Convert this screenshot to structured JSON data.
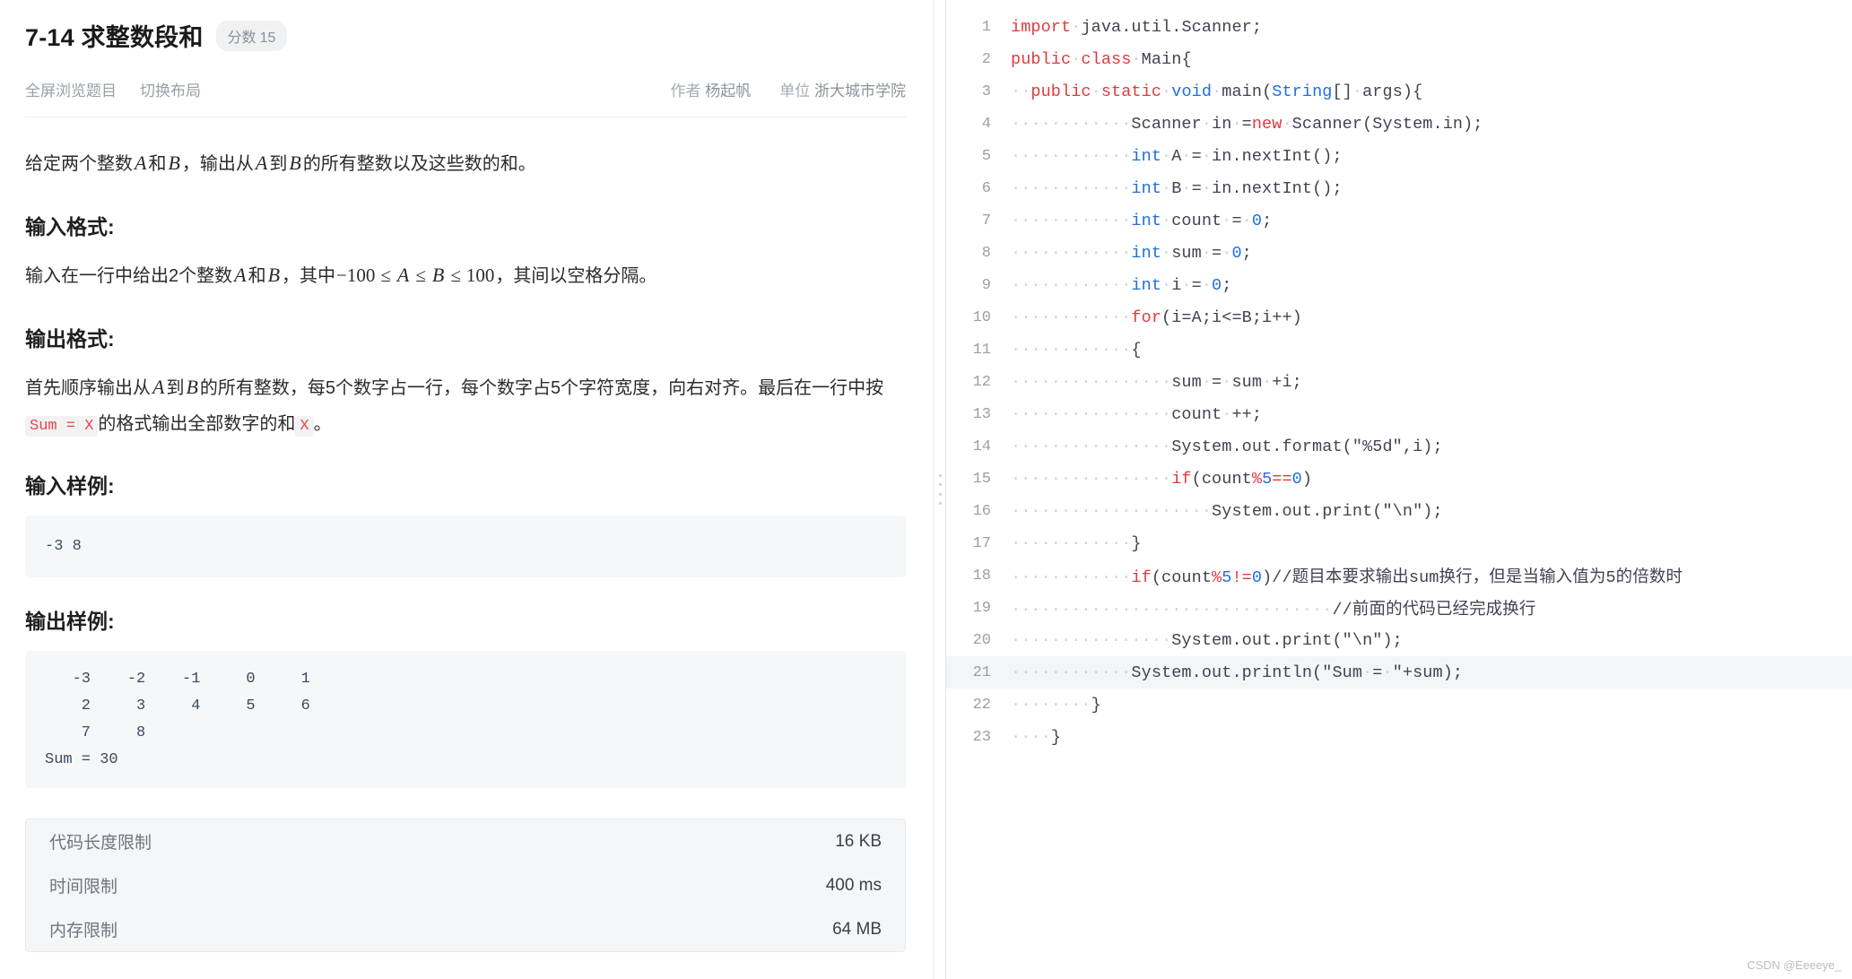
{
  "problem": {
    "title": "7-14 求整数段和",
    "score_label": "分数",
    "score_value": "15",
    "actions": [
      "全屏浏览题目",
      "切换布局"
    ],
    "author_label": "作者",
    "author_name": "杨起帆",
    "org_label": "单位",
    "org_name": "浙大城市学院",
    "description": {
      "p1_a": "给定两个整数",
      "var_A": "A",
      "p1_b": "和",
      "var_B": "B",
      "p1_c": "，输出从",
      "p1_d": "到",
      "p1_e": "的所有整数以及这些数的和。"
    },
    "input_section": {
      "heading": "输入格式:",
      "t1": "输入在一行中给出2个整数",
      "t2": "和",
      "t3": "，其中",
      "neg100": "−100",
      "le1": "≤",
      "le2": "≤",
      "le3": "≤",
      "p100": "100",
      "t4": "，其间以空格分隔。"
    },
    "output_section": {
      "heading": "输出格式:",
      "t1": "首先顺序输出从",
      "t2": "到",
      "t3": "的所有整数，每5个数字占一行，每个数字占5个字符宽度，向右对齐。最后在一行中按",
      "code1": "Sum = X",
      "t4": "的格式输出全部数字的和",
      "code2": "X",
      "t5": "。"
    },
    "input_sample": {
      "heading": "输入样例:",
      "text": "-3 8"
    },
    "output_sample": {
      "heading": "输出样例:",
      "text": "   -3    -2    -1     0     1\n    2     3     4     5     6\n    7     8\nSum = 30"
    },
    "limits": [
      {
        "label": "代码长度限制",
        "value": "16 KB"
      },
      {
        "label": "时间限制",
        "value": "400 ms"
      },
      {
        "label": "内存限制",
        "value": "64 MB"
      }
    ]
  },
  "editor": {
    "highlighted_line": 21,
    "lines": [
      {
        "n": "1",
        "tokens": [
          {
            "t": "import",
            "c": "kw"
          },
          {
            "t": "·",
            "c": "ws"
          },
          {
            "t": "java.util.Scanner;",
            "c": ""
          }
        ]
      },
      {
        "n": "2",
        "tokens": [
          {
            "t": "public",
            "c": "kw"
          },
          {
            "t": "·",
            "c": "ws"
          },
          {
            "t": "class",
            "c": "kw"
          },
          {
            "t": "·",
            "c": "ws"
          },
          {
            "t": "Main{",
            "c": ""
          }
        ]
      },
      {
        "n": "3",
        "tokens": [
          {
            "t": "··",
            "c": "ws"
          },
          {
            "t": "public",
            "c": "kw"
          },
          {
            "t": "·",
            "c": "ws"
          },
          {
            "t": "static",
            "c": "kw"
          },
          {
            "t": "·",
            "c": "ws"
          },
          {
            "t": "void",
            "c": "ty"
          },
          {
            "t": "·",
            "c": "ws"
          },
          {
            "t": "main(",
            "c": ""
          },
          {
            "t": "String",
            "c": "ty"
          },
          {
            "t": "[]",
            "c": ""
          },
          {
            "t": "·",
            "c": "ws"
          },
          {
            "t": "args){",
            "c": ""
          }
        ]
      },
      {
        "n": "4",
        "tokens": [
          {
            "t": "············",
            "c": "ws"
          },
          {
            "t": "Scanner",
            "c": ""
          },
          {
            "t": "·",
            "c": "ws"
          },
          {
            "t": "in",
            "c": ""
          },
          {
            "t": "·",
            "c": "ws"
          },
          {
            "t": "=",
            "c": ""
          },
          {
            "t": "new",
            "c": "kw"
          },
          {
            "t": "·",
            "c": "ws"
          },
          {
            "t": "Scanner(System.in);",
            "c": ""
          }
        ]
      },
      {
        "n": "5",
        "tokens": [
          {
            "t": "············",
            "c": "ws"
          },
          {
            "t": "int",
            "c": "ty"
          },
          {
            "t": "·",
            "c": "ws"
          },
          {
            "t": "A",
            "c": ""
          },
          {
            "t": "·",
            "c": "ws"
          },
          {
            "t": "=",
            "c": ""
          },
          {
            "t": "·",
            "c": "ws"
          },
          {
            "t": "in.nextInt();",
            "c": ""
          }
        ]
      },
      {
        "n": "6",
        "tokens": [
          {
            "t": "············",
            "c": "ws"
          },
          {
            "t": "int",
            "c": "ty"
          },
          {
            "t": "·",
            "c": "ws"
          },
          {
            "t": "B",
            "c": ""
          },
          {
            "t": "·",
            "c": "ws"
          },
          {
            "t": "=",
            "c": ""
          },
          {
            "t": "·",
            "c": "ws"
          },
          {
            "t": "in.nextInt();",
            "c": ""
          }
        ]
      },
      {
        "n": "7",
        "tokens": [
          {
            "t": "············",
            "c": "ws"
          },
          {
            "t": "int",
            "c": "ty"
          },
          {
            "t": "·",
            "c": "ws"
          },
          {
            "t": "count",
            "c": ""
          },
          {
            "t": "·",
            "c": "ws"
          },
          {
            "t": "=",
            "c": ""
          },
          {
            "t": "·",
            "c": "ws"
          },
          {
            "t": "0",
            "c": "num"
          },
          {
            "t": ";",
            "c": ""
          }
        ]
      },
      {
        "n": "8",
        "tokens": [
          {
            "t": "············",
            "c": "ws"
          },
          {
            "t": "int",
            "c": "ty"
          },
          {
            "t": "·",
            "c": "ws"
          },
          {
            "t": "sum",
            "c": ""
          },
          {
            "t": "·",
            "c": "ws"
          },
          {
            "t": "=",
            "c": ""
          },
          {
            "t": "·",
            "c": "ws"
          },
          {
            "t": "0",
            "c": "num"
          },
          {
            "t": ";",
            "c": ""
          }
        ]
      },
      {
        "n": "9",
        "tokens": [
          {
            "t": "············",
            "c": "ws"
          },
          {
            "t": "int",
            "c": "ty"
          },
          {
            "t": "·",
            "c": "ws"
          },
          {
            "t": "i",
            "c": ""
          },
          {
            "t": "·",
            "c": "ws"
          },
          {
            "t": "=",
            "c": ""
          },
          {
            "t": "·",
            "c": "ws"
          },
          {
            "t": "0",
            "c": "num"
          },
          {
            "t": ";",
            "c": ""
          }
        ]
      },
      {
        "n": "10",
        "tokens": [
          {
            "t": "············",
            "c": "ws"
          },
          {
            "t": "for",
            "c": "kw"
          },
          {
            "t": "(i=A;i<=B;i++)",
            "c": ""
          }
        ]
      },
      {
        "n": "11",
        "tokens": [
          {
            "t": "············",
            "c": "ws"
          },
          {
            "t": "{",
            "c": ""
          }
        ]
      },
      {
        "n": "12",
        "tokens": [
          {
            "t": "················",
            "c": "ws"
          },
          {
            "t": "sum",
            "c": ""
          },
          {
            "t": "·",
            "c": "ws"
          },
          {
            "t": "=",
            "c": ""
          },
          {
            "t": "·",
            "c": "ws"
          },
          {
            "t": "sum",
            "c": ""
          },
          {
            "t": "·",
            "c": "ws"
          },
          {
            "t": "+i;",
            "c": ""
          }
        ]
      },
      {
        "n": "13",
        "tokens": [
          {
            "t": "················",
            "c": "ws"
          },
          {
            "t": "count",
            "c": ""
          },
          {
            "t": "·",
            "c": "ws"
          },
          {
            "t": "++;",
            "c": ""
          }
        ]
      },
      {
        "n": "14",
        "tokens": [
          {
            "t": "················",
            "c": "ws"
          },
          {
            "t": "System.out.format(",
            "c": ""
          },
          {
            "t": "\"%5d\"",
            "c": "str"
          },
          {
            "t": ",i);",
            "c": ""
          }
        ]
      },
      {
        "n": "15",
        "tokens": [
          {
            "t": "················",
            "c": "ws"
          },
          {
            "t": "if",
            "c": "kw"
          },
          {
            "t": "(count",
            "c": ""
          },
          {
            "t": "%",
            "c": "kw"
          },
          {
            "t": "5",
            "c": "num"
          },
          {
            "t": "==",
            "c": "kw"
          },
          {
            "t": "0",
            "c": "num"
          },
          {
            "t": ")",
            "c": ""
          }
        ]
      },
      {
        "n": "16",
        "tokens": [
          {
            "t": "····················",
            "c": "ws"
          },
          {
            "t": "System.out.print(",
            "c": ""
          },
          {
            "t": "\"\\n\"",
            "c": "str"
          },
          {
            "t": ");",
            "c": ""
          }
        ]
      },
      {
        "n": "17",
        "tokens": [
          {
            "t": "············",
            "c": "ws"
          },
          {
            "t": "}",
            "c": ""
          }
        ]
      },
      {
        "n": "18",
        "tokens": [
          {
            "t": "············",
            "c": "ws"
          },
          {
            "t": "if",
            "c": "kw"
          },
          {
            "t": "(count",
            "c": ""
          },
          {
            "t": "%",
            "c": "kw"
          },
          {
            "t": "5",
            "c": "num"
          },
          {
            "t": "!=",
            "c": "kw"
          },
          {
            "t": "0",
            "c": "num"
          },
          {
            "t": ")",
            "c": ""
          },
          {
            "t": "//题目本要求输出sum换行，但是当输入值为5的倍数时",
            "c": "cmt"
          }
        ]
      },
      {
        "n": "19",
        "tokens": [
          {
            "t": "································",
            "c": "ws"
          },
          {
            "t": "//前面的代码已经完成换行",
            "c": "cmt"
          }
        ]
      },
      {
        "n": "20",
        "tokens": [
          {
            "t": "················",
            "c": "ws"
          },
          {
            "t": "System.out.print(",
            "c": ""
          },
          {
            "t": "\"\\n\"",
            "c": "str"
          },
          {
            "t": ");",
            "c": ""
          }
        ]
      },
      {
        "n": "21",
        "tokens": [
          {
            "t": "············",
            "c": "ws"
          },
          {
            "t": "System.out.println(",
            "c": ""
          },
          {
            "t": "\"Sum",
            "c": "str"
          },
          {
            "t": "·",
            "c": "ws"
          },
          {
            "t": "=",
            "c": "str"
          },
          {
            "t": "·",
            "c": "ws"
          },
          {
            "t": "\"",
            "c": "str"
          },
          {
            "t": "+sum);",
            "c": ""
          }
        ]
      },
      {
        "n": "22",
        "tokens": [
          {
            "t": "········",
            "c": "ws"
          },
          {
            "t": "}",
            "c": ""
          }
        ]
      },
      {
        "n": "23",
        "tokens": [
          {
            "t": "····",
            "c": "ws"
          },
          {
            "t": "}",
            "c": ""
          }
        ]
      }
    ]
  },
  "watermark": "CSDN @Eeeeye_"
}
